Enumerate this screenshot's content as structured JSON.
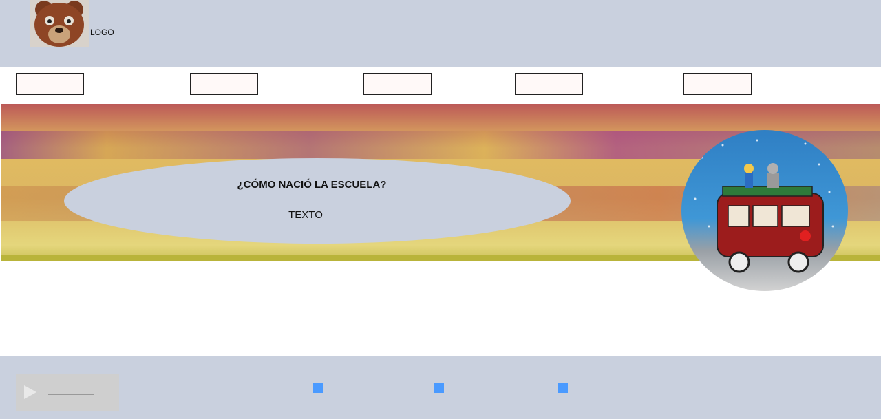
{
  "header": {
    "logo_text": "LOGO",
    "logo_icon": "bear-head-icon"
  },
  "nav": {
    "buttons": [
      "",
      "",
      "",
      "",
      ""
    ]
  },
  "hero": {
    "title": "¿CÓMO NACIÓ LA ESCUELA?",
    "text": "TEXTO",
    "image": "van-illustration"
  },
  "footer": {
    "player_icon": "play-icon",
    "dots": [
      "",
      "",
      ""
    ]
  },
  "colors": {
    "header_bg": "#c9d0de",
    "accent": "#4a9aff"
  }
}
